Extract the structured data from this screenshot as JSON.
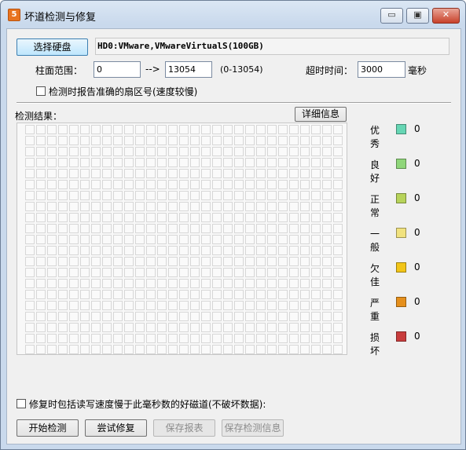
{
  "window": {
    "title": "坏道检测与修复",
    "app_icon_glyph": "5",
    "controls": {
      "minimize": "▭",
      "maximize": "▣",
      "close": "✕"
    }
  },
  "disk": {
    "select_button": "选择硬盘",
    "current": "HD0:VMware,VMwareVirtualS(100GB)"
  },
  "range": {
    "label": "柱面范围：",
    "from": "0",
    "arrow": "-->",
    "to": "13054",
    "hint": "(0-13054)"
  },
  "timeout": {
    "label": "超时时间：",
    "value": "3000",
    "unit": "毫秒"
  },
  "options": {
    "report_sector_label": "检测时报告准确的扇区号(速度较慢)",
    "report_sector_checked": false,
    "repair_slow_label": "修复时包括读写速度慢于此毫秒数的好磁道(不破坏数据):",
    "repair_slow_checked": false
  },
  "results": {
    "label": "检测结果：",
    "details_button": "详细信息"
  },
  "legend": [
    {
      "name": "优秀",
      "count": "0",
      "color": "#66d6b4"
    },
    {
      "name": "良好",
      "count": "0",
      "color": "#8fd67a"
    },
    {
      "name": "正常",
      "count": "0",
      "color": "#b7d35a"
    },
    {
      "name": "一般",
      "count": "0",
      "color": "#f1e27e"
    },
    {
      "name": "欠佳",
      "count": "0",
      "color": "#f2c518"
    },
    {
      "name": "严重",
      "count": "0",
      "color": "#e58f1c"
    },
    {
      "name": "损坏",
      "count": "0",
      "color": "#c83c3c"
    }
  ],
  "actions": {
    "start": "开始检测",
    "try_repair": "尝试修复",
    "save_report": "保存报表",
    "save_info": "保存检测信息"
  }
}
